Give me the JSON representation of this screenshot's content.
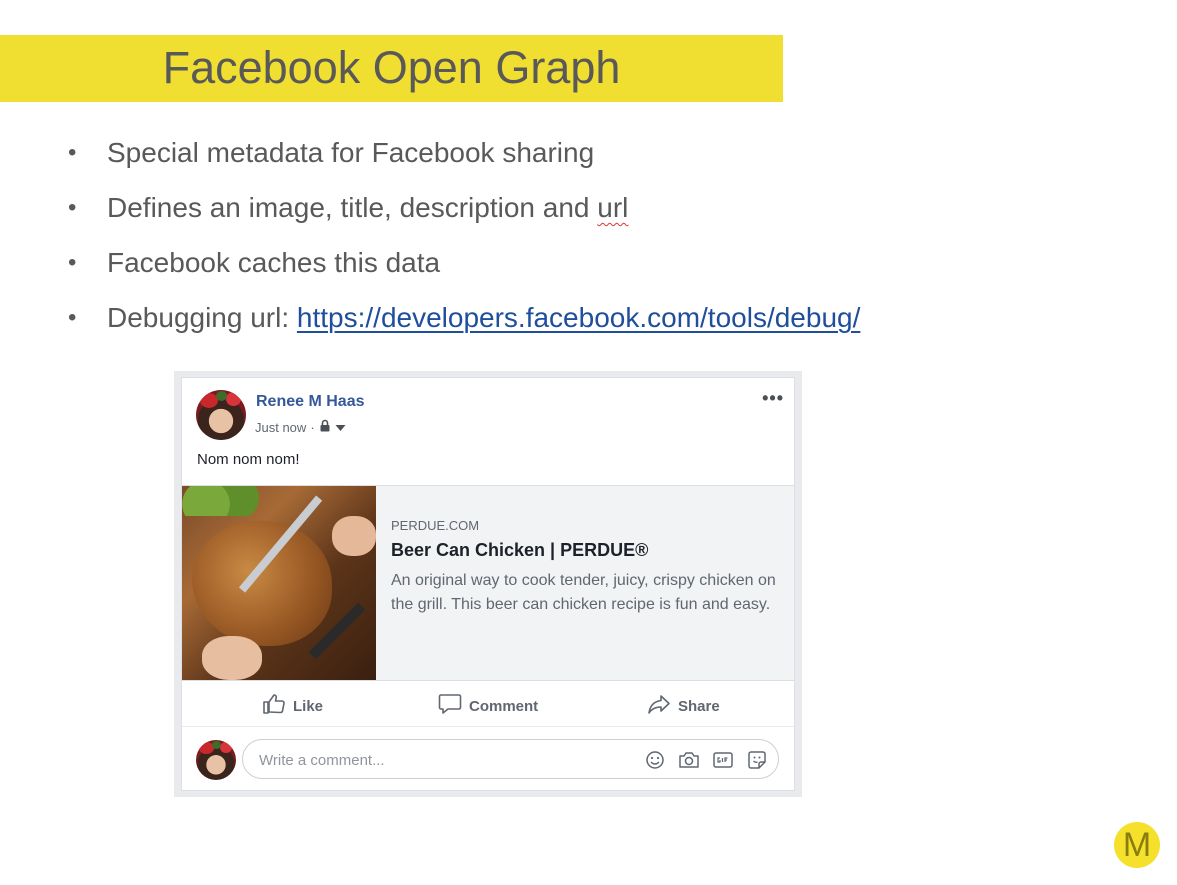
{
  "slide": {
    "title": "Facebook Open Graph",
    "bullets": [
      {
        "text": "Special metadata for Facebook sharing"
      },
      {
        "text_before": "Defines an image, title, description and ",
        "flagged_word": "url"
      },
      {
        "text": "Facebook caches this data"
      },
      {
        "text_before": "Debugging url: ",
        "link": "https://developers.facebook.com/tools/debug/"
      }
    ],
    "bullet_glyph": "•",
    "logo_letter": "M"
  },
  "post": {
    "author": "Renee M Haas",
    "time": "Just now",
    "separator": "·",
    "more_glyph": "•••",
    "text": "Nom nom nom!",
    "link_preview": {
      "domain": "PERDUE.COM",
      "title": "Beer Can Chicken | PERDUE®",
      "description": "An original way to cook tender, juicy, crispy chicken on the grill. This beer can chicken recipe is fun and easy."
    },
    "actions": {
      "like": "Like",
      "comment": "Comment",
      "share": "Share"
    },
    "comment_placeholder": "Write a comment..."
  },
  "colors": {
    "title_bar": "#f0de30",
    "link": "#1f4e9c",
    "fb_blue": "#365899"
  },
  "icons": [
    "lock-icon",
    "caret-down-icon",
    "more-options-icon",
    "like-icon",
    "comment-icon",
    "share-icon",
    "emoji-icon",
    "camera-icon",
    "gif-icon",
    "sticker-icon"
  ]
}
